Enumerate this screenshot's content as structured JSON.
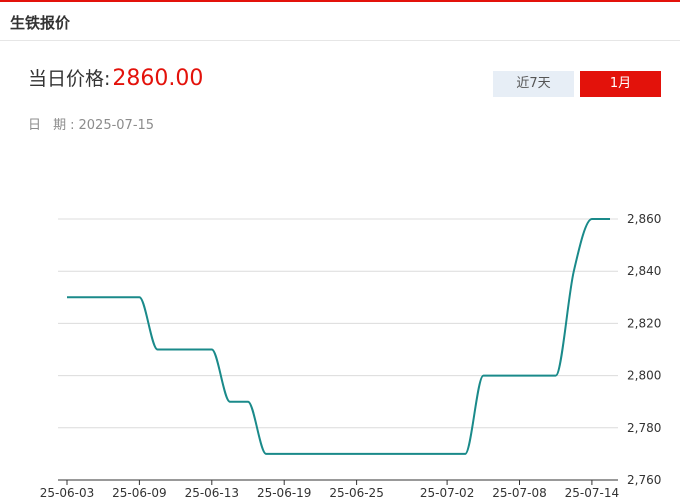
{
  "header": {
    "title": "生铁报价"
  },
  "price": {
    "label": "当日价格:",
    "value": "2860.00"
  },
  "date": {
    "label": "日 期:",
    "value": "2025-07-15"
  },
  "range_buttons": [
    {
      "label": "近7天",
      "active": false
    },
    {
      "label": "1月",
      "active": true
    }
  ],
  "colors": {
    "accent": "#e3120b",
    "line": "#1a8a8a",
    "grid": "#dcdcdc",
    "inactive_button": "#e7eef6"
  },
  "chart_data": {
    "type": "line",
    "title": "",
    "xlabel": "",
    "ylabel": "",
    "ylim": [
      2760,
      2860
    ],
    "y_ticks": [
      "2,760",
      "2,780",
      "2,800",
      "2,820",
      "2,840",
      "2,860"
    ],
    "x_tick_labels": [
      "25-06-03",
      "25-06-09",
      "25-06-13",
      "25-06-19",
      "25-06-25",
      "25-07-02",
      "25-07-08",
      "25-07-14"
    ],
    "x": [
      "25-06-03",
      "25-06-04",
      "25-06-05",
      "25-06-06",
      "25-06-09",
      "25-06-10",
      "25-06-11",
      "25-06-12",
      "25-06-13",
      "25-06-16",
      "25-06-17",
      "25-06-18",
      "25-06-19",
      "25-06-20",
      "25-06-23",
      "25-06-24",
      "25-06-25",
      "25-06-26",
      "25-06-27",
      "25-06-30",
      "25-07-01",
      "25-07-02",
      "25-07-03",
      "25-07-04",
      "25-07-07",
      "25-07-08",
      "25-07-09",
      "25-07-10",
      "25-07-11",
      "25-07-14",
      "25-07-15"
    ],
    "series": [
      {
        "values": [
          2830,
          2830,
          2830,
          2830,
          2830,
          2810,
          2810,
          2810,
          2810,
          2790,
          2790,
          2770,
          2770,
          2770,
          2770,
          2770,
          2770,
          2770,
          2770,
          2770,
          2770,
          2770,
          2770,
          2800,
          2800,
          2800,
          2800,
          2800,
          2840,
          2860,
          2860
        ]
      }
    ],
    "grid": true,
    "legend": "none"
  }
}
